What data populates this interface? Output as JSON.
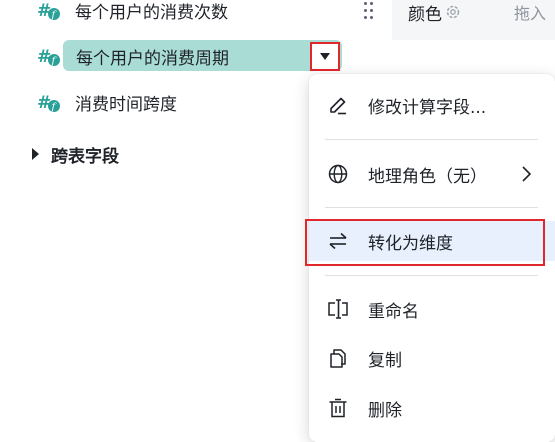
{
  "fields": [
    {
      "label": "每个用户的消费次数"
    },
    {
      "label": "每个用户的消费周期"
    },
    {
      "label": "消费时间跨度"
    }
  ],
  "cross_table": {
    "label": "跨表字段"
  },
  "right_panel": {
    "color_label": "颜色",
    "drag_hint": "拖入"
  },
  "menu": {
    "items": [
      {
        "label": "修改计算字段..."
      },
      {
        "label": "地理角色（无）"
      },
      {
        "label": "转化为维度"
      },
      {
        "label": "重命名"
      },
      {
        "label": "复制"
      },
      {
        "label": "删除"
      }
    ]
  },
  "colors": {
    "accent_teal": "#2aa198",
    "selected_bg": "#a8dcd4",
    "highlight_red": "#e0272c",
    "active_bg": "#e8f0fd"
  }
}
